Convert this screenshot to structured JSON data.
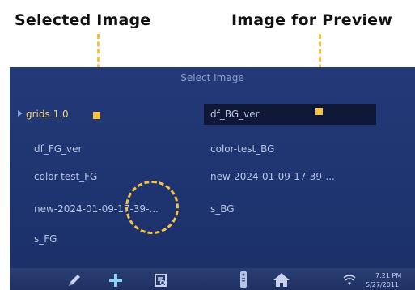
{
  "annotations": {
    "left_label": "Selected Image",
    "right_label": "Image for Preview"
  },
  "screen": {
    "title": "Select Image",
    "left_column": [
      {
        "label": "grids 1.0",
        "selected": true
      },
      {
        "label": "df_FG_ver"
      },
      {
        "label": "color-test_FG"
      },
      {
        "label": "new-2024-01-09-17-39-..."
      },
      {
        "label": "s_FG"
      }
    ],
    "right_column": [
      {
        "label": "df_BG_ver",
        "highlighted": true
      },
      {
        "label": "color-test_BG"
      },
      {
        "label": "new-2024-01-09-17-39-..."
      },
      {
        "label": "s_BG"
      }
    ]
  },
  "taskbar": {
    "icons": [
      "pencil-icon",
      "plus-icon",
      "preview-icon",
      "remote-icon",
      "home-icon",
      "wifi-icon"
    ],
    "time": "7:21 PM",
    "date": "5/27/2011"
  },
  "colors": {
    "marker": "#f5c242",
    "screen_bg": "#1e3470",
    "selected_text": "#f3d07a"
  }
}
